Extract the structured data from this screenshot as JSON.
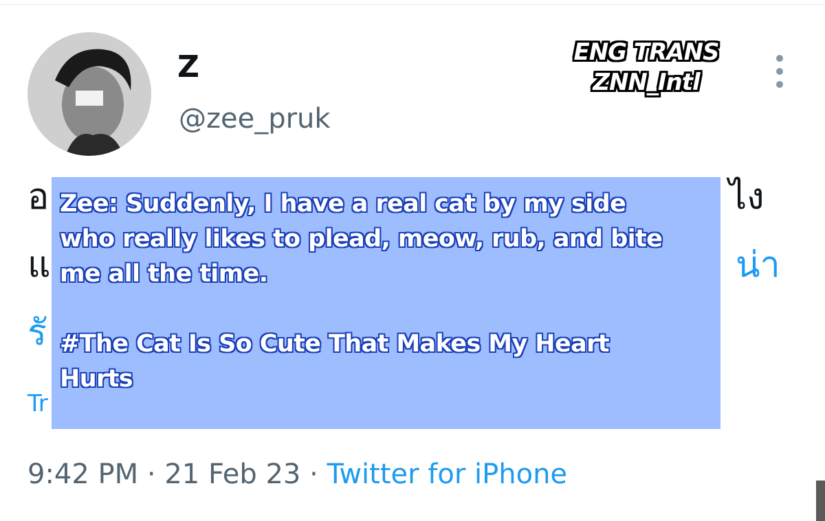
{
  "tweet": {
    "display_name": "Z",
    "handle": "@zee_pruk",
    "body_lines": [
      "อ",
      "แ",
      "รั"
    ],
    "body_right_fragments": [
      "ไง",
      "น่า"
    ],
    "translate_fragment": "Tr",
    "time": "9:42 PM",
    "separator": "·",
    "date": "21 Feb 23",
    "source": "Twitter for iPhone"
  },
  "watermark": {
    "line1": "ENG TRANS",
    "line2": "ZNN_Intl"
  },
  "translation": {
    "line1": "Zee: Suddenly, I have a real cat by my side",
    "line2": "who really likes to plead, meow, rub, and bite",
    "line3": "me all the time.",
    "hashtag_line1": "#The Cat Is So Cute That Makes My Heart",
    "hashtag_line2": "Hurts"
  },
  "icons": {
    "more": "more-vertical-icon"
  },
  "colors": {
    "link": "#1d9bf0",
    "secondary_text": "#536471",
    "overlay": "#96b8ff"
  }
}
